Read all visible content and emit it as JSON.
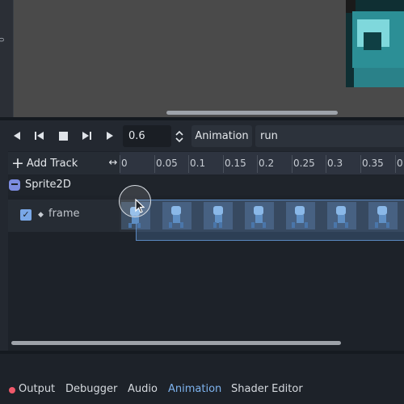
{
  "viewport": {
    "ruler_tick": "0"
  },
  "toolbar": {
    "time_value": "0.6",
    "animation_button": "Animation",
    "animation_name": "run"
  },
  "track_header": {
    "add_track_label": "Add Track",
    "ticks": [
      "0",
      "0.05",
      "0.1",
      "0.15",
      "0.2",
      "0.25",
      "0.3",
      "0.35",
      "0"
    ]
  },
  "tracks": {
    "node_label": "Sprite2D",
    "track_label": "frame",
    "track_checked": true
  },
  "dock": {
    "tabs": [
      "Output",
      "Debugger",
      "Audio",
      "Animation",
      "Shader Editor"
    ],
    "active_tab": "Animation"
  },
  "colors": {
    "accent": "#7eb3ee",
    "error_dot": "#f0596a",
    "node_icon": "#7c8ce0"
  },
  "icons": [
    "play-backward-icon",
    "step-back-icon",
    "stop-icon",
    "step-forward-icon",
    "play-icon",
    "spinner-icon",
    "plus-icon",
    "expand-icon",
    "godot-node-icon",
    "checkbox-icon",
    "diamond-icon"
  ]
}
